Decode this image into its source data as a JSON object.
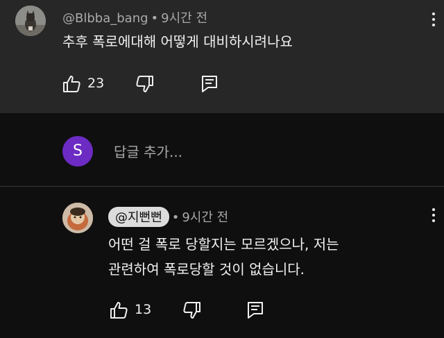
{
  "comments": [
    {
      "author": "@Blbba_bang",
      "time": "9시간 전",
      "text": "추후 폭로에대해 어떻게 대비하시려나요",
      "likes": "23"
    },
    {
      "author": "@지뻔뻔",
      "time": "9시간 전",
      "text_line1": "어떤 걸 폭로 당할지는 모르겠으나, 저는",
      "text_line2": "관련하여 폭로당할 것이 없습니다.",
      "likes": "13"
    }
  ],
  "reply_box": {
    "avatar_letter": "S",
    "avatar_color": "#6c2bc2",
    "placeholder": "답글 추가..."
  },
  "separator": "•",
  "icons": {
    "like": "thumbs-up-icon",
    "dislike": "thumbs-down-icon",
    "reply": "reply-comment-icon",
    "more": "more-vertical-icon"
  }
}
